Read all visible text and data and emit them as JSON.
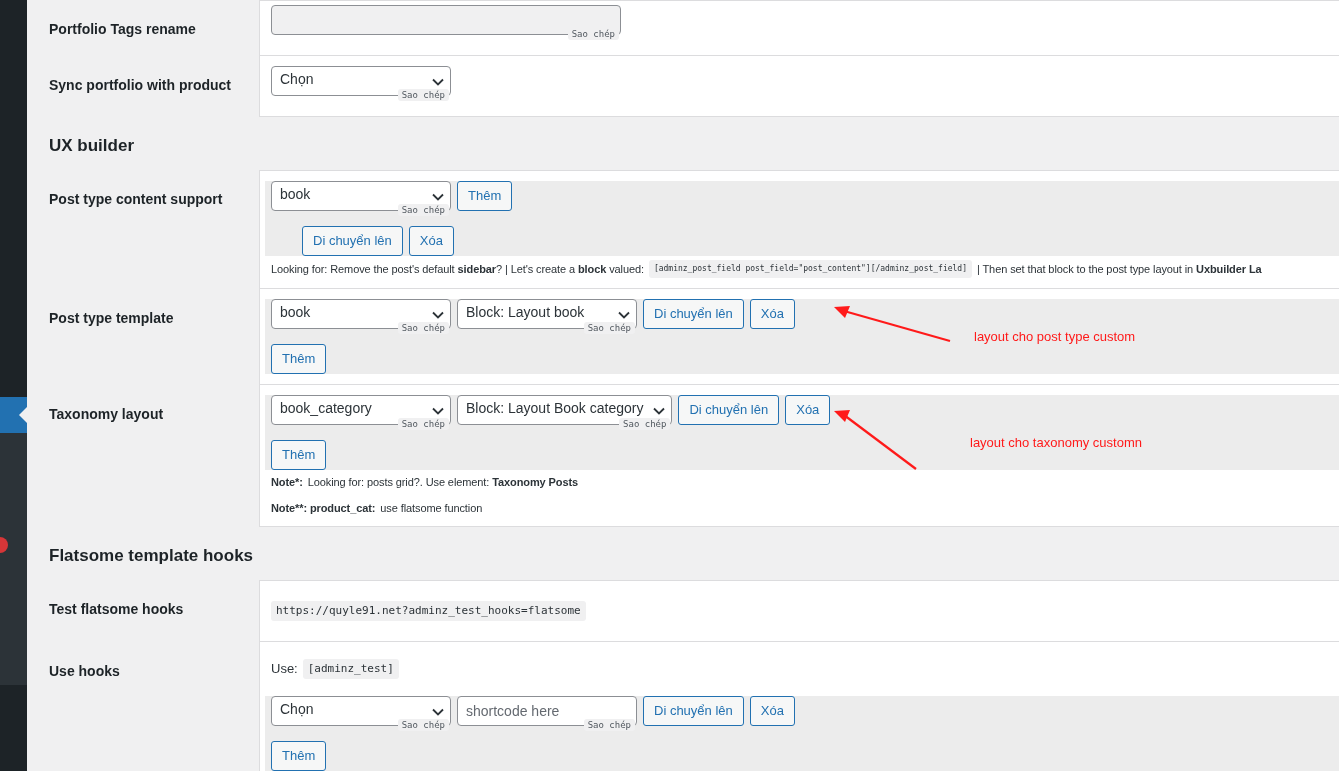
{
  "sidebar": {
    "items": [
      {
        "selected": true,
        "has_badge": false
      },
      {
        "selected": false,
        "has_badge": false
      },
      {
        "selected": false,
        "has_badge": false
      },
      {
        "selected": false,
        "has_badge": false
      },
      {
        "selected": false,
        "has_badge": true
      },
      {
        "selected": false,
        "has_badge": false
      },
      {
        "selected": false,
        "has_badge": false
      },
      {
        "selected": false,
        "has_badge": false
      }
    ]
  },
  "sections": [
    {
      "rows": [
        {
          "label": "Portfolio Tags rename",
          "kind": "field",
          "lines": [
            [
              {
                "kind": "text_input",
                "disabled": true,
                "copy_label": "Sao chép"
              }
            ]
          ]
        },
        {
          "label": "Sync portfolio with product",
          "kind": "field",
          "lines": [
            [
              {
                "kind": "select",
                "value": "Chọn",
                "copy_label": "Sao chép"
              }
            ]
          ]
        }
      ]
    },
    {
      "heading": "UX builder",
      "rows": [
        {
          "label": "Post type content support",
          "kind": "repeater",
          "lines": [
            [
              {
                "kind": "select",
                "value": "book",
                "copy_label": "Sao chép"
              },
              {
                "kind": "button",
                "label": "Thêm"
              }
            ],
            [
              {
                "kind": "button",
                "label": "Di chuyển lên"
              },
              {
                "kind": "button",
                "label": "Xóa"
              }
            ]
          ],
          "notes": [
            [
              {
                "kind": "text",
                "text": "Looking for: Remove the post's default **sidebar**? | Let's create a **block** valued:"
              },
              {
                "kind": "code",
                "text": "[adminz_post_field post_field=\"post_content\"][/adminz_post_field]"
              },
              {
                "kind": "text",
                "text": "| Then set that block to the post type layout in **Uxbuilder La**"
              }
            ]
          ]
        },
        {
          "label": "Post type template",
          "kind": "repeater",
          "annotation": "layout cho post type custom",
          "lines": [
            [
              {
                "kind": "select",
                "value": "book",
                "copy_label": "Sao chép"
              },
              {
                "kind": "select",
                "value": "Block: Layout book",
                "copy_label": "Sao chép"
              },
              {
                "kind": "button",
                "label": "Di chuyển lên"
              },
              {
                "kind": "button",
                "label": "Xóa"
              }
            ],
            [
              {
                "kind": "button",
                "label": "Thêm"
              }
            ]
          ]
        },
        {
          "label": "Taxonomy layout",
          "kind": "repeater",
          "annotation": "layout cho taxonomy customn",
          "lines": [
            [
              {
                "kind": "select",
                "value": "book_category",
                "copy_label": "Sao chép"
              },
              {
                "kind": "select",
                "value": "Block: Layout Book category",
                "copy_label": "Sao chép"
              },
              {
                "kind": "button",
                "label": "Di chuyển lên"
              },
              {
                "kind": "button",
                "label": "Xóa"
              }
            ],
            [
              {
                "kind": "button",
                "label": "Thêm"
              }
            ]
          ],
          "notes": [
            [
              {
                "kind": "bold",
                "text": "Note*:"
              },
              {
                "kind": "text",
                "text": "Looking for: posts grid?. Use element: **Taxonomy Posts**"
              }
            ],
            [
              {
                "kind": "bold",
                "text": "Note**: product_cat:"
              },
              {
                "kind": "text",
                "text": "use flatsome function"
              }
            ]
          ]
        }
      ]
    },
    {
      "heading": "Flatsome template hooks",
      "rows": [
        {
          "label": "Test flatsome hooks",
          "kind": "field",
          "intro": [
            {
              "kind": "code",
              "text": "https://quyle91.net?adminz_test_hooks=flatsome"
            }
          ]
        },
        {
          "label": "Use hooks",
          "kind": "repeater",
          "intro": [
            {
              "kind": "text",
              "text": "Use:"
            },
            {
              "kind": "code",
              "text": "[adminz_test]"
            }
          ],
          "lines": [
            [
              {
                "kind": "select",
                "value": "Chọn",
                "copy_label": "Sao chép"
              },
              {
                "kind": "text_input",
                "placeholder": "shortcode here",
                "copy_label": "Sao chép"
              },
              {
                "kind": "button",
                "label": "Di chuyển lên"
              },
              {
                "kind": "button",
                "label": "Xóa"
              }
            ],
            [
              {
                "kind": "button",
                "label": "Thêm"
              }
            ]
          ]
        }
      ]
    }
  ]
}
